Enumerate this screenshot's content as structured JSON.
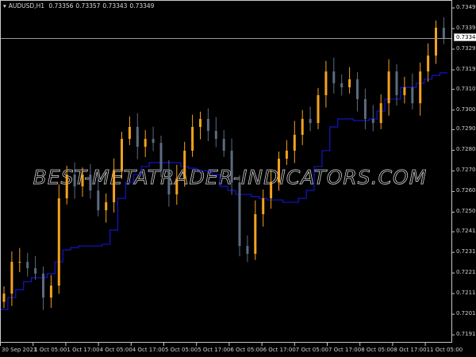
{
  "header": {
    "symbol": "AUDUSD,H1",
    "open": "0.73356",
    "high": "0.73357",
    "low": "0.73343",
    "close": "0.73349"
  },
  "watermark": "BEST-METATRADER-INDICATORS.COM",
  "current_price_label": "0.73349",
  "colors": {
    "background": "#000000",
    "bull_candle": "#f5a21e",
    "bear_candle": "#5b6b80",
    "indicator_line": "#1414c8",
    "axis": "#c8c8c8",
    "crosshair": "#9a9a9a"
  },
  "chart_data": {
    "type": "candlestick",
    "symbol": "AUDUSD",
    "timeframe": "H1",
    "ylim": [
      0.7188,
      0.7353
    ],
    "price_ticks": [
      "0.73495",
      "0.73395",
      "0.73295",
      "0.73195",
      "0.73100",
      "0.73000",
      "0.72905",
      "0.72805",
      "0.72705",
      "0.72605",
      "0.72505",
      "0.72410",
      "0.72310",
      "0.72210",
      "0.72110",
      "0.72010",
      "0.71910"
    ],
    "time_ticks": [
      "30 Sep 2021",
      "1 Oct 05:00",
      "1 Oct 17:00",
      "4 Oct 05:00",
      "4 Oct 17:00",
      "5 Oct 05:00",
      "5 Oct 17:00",
      "6 Oct 05:00",
      "6 Oct 17:00",
      "7 Oct 05:00",
      "7 Oct 17:00",
      "8 Oct 05:00",
      "8 Oct 17:00",
      "11 Oct 05:00"
    ],
    "closes": [
      0.7211,
      0.72264,
      0.72264,
      0.72233,
      0.72207,
      0.72091,
      0.72149,
      0.72572,
      0.72687,
      0.7263,
      0.72687,
      0.7261,
      0.72514,
      0.72553,
      0.72706,
      0.7286,
      0.72918,
      0.72822,
      0.7286,
      0.72841,
      0.72706,
      0.72591,
      0.72668,
      0.72803,
      0.72918,
      0.72957,
      0.72899,
      0.7286,
      0.72803,
      0.72649,
      0.72341,
      0.72303,
      0.72495,
      0.72572,
      0.72649,
      0.72764,
      0.72803,
      0.7288,
      0.72957,
      0.72937,
      0.73072,
      0.73187,
      0.7313,
      0.7311,
      0.73149,
      0.73053,
      0.72957,
      0.72937,
      0.73033,
      0.73187,
      0.73072,
      0.7311,
      0.73033,
      0.73187,
      0.73264,
      0.73399,
      0.73349
    ],
    "indicator": [
      0.72033,
      0.72091,
      0.72129,
      0.72168,
      0.72187,
      0.72187,
      0.72207,
      0.72264,
      0.72322,
      0.72333,
      0.72341,
      0.72341,
      0.72341,
      0.72349,
      0.72418,
      0.72572,
      0.72649,
      0.72687,
      0.72726,
      0.72745,
      0.72745,
      0.72745,
      0.72745,
      0.72726,
      0.72718,
      0.72706,
      0.72706,
      0.72687,
      0.7263,
      0.7261,
      0.72591,
      0.72591,
      0.7258,
      0.72572,
      0.72564,
      0.72564,
      0.72553,
      0.72553,
      0.72572,
      0.7261,
      0.72726,
      0.72803,
      0.72918,
      0.72957,
      0.72957,
      0.72949,
      0.72949,
      0.72957,
      0.72995,
      0.73053,
      0.73053,
      0.7311,
      0.7311,
      0.7313,
      0.73149,
      0.73168,
      0.7318
    ],
    "current_price": 0.73349
  }
}
